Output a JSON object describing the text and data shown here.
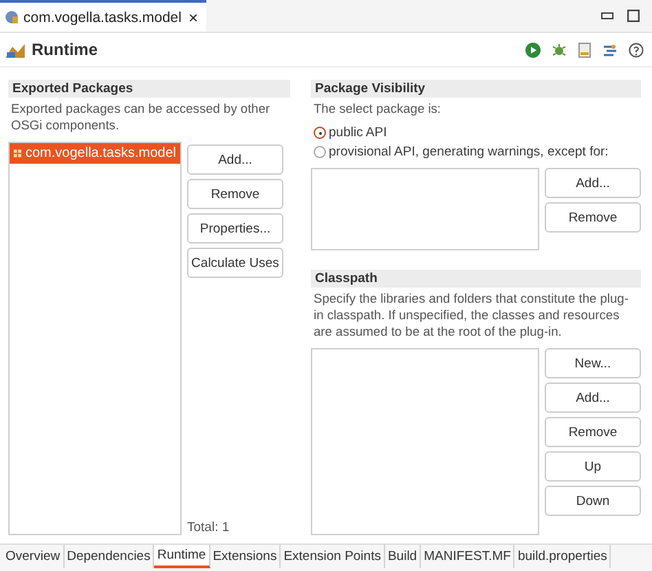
{
  "editor_tab": {
    "title": "com.vogella.tasks.model",
    "close": "×"
  },
  "page": {
    "title": "Runtime"
  },
  "exported_packages": {
    "title": "Exported Packages",
    "description": "Exported packages can be accessed by other OSGi components.",
    "items": [
      {
        "label": "com.vogella.tasks.model",
        "selected": true
      }
    ],
    "buttons": [
      "Add...",
      "Remove",
      "Properties...",
      "Calculate Uses"
    ],
    "total": "Total: 1"
  },
  "package_visibility": {
    "title": "Package Visibility",
    "description": "The select package is:",
    "options": [
      {
        "label": "public API",
        "selected": true
      },
      {
        "label": "provisional API, generating warnings, except for:",
        "selected": false
      }
    ],
    "buttons": [
      "Add...",
      "Remove"
    ]
  },
  "classpath": {
    "title": "Classpath",
    "description": "Specify the libraries and folders that constitute the plug-in classpath.  If unspecified, the classes and resources are assumed to be at the root of the plug-in.",
    "buttons": [
      "New...",
      "Add...",
      "Remove",
      "Up",
      "Down"
    ]
  },
  "bottom_tabs": [
    {
      "label": "Overview",
      "selected": false
    },
    {
      "label": "Dependencies",
      "selected": false
    },
    {
      "label": "Runtime",
      "selected": true
    },
    {
      "label": "Extensions",
      "selected": false
    },
    {
      "label": "Extension Points",
      "selected": false
    },
    {
      "label": "Build",
      "selected": false
    },
    {
      "label": "MANIFEST.MF",
      "selected": false
    },
    {
      "label": "build.properties",
      "selected": false
    }
  ]
}
